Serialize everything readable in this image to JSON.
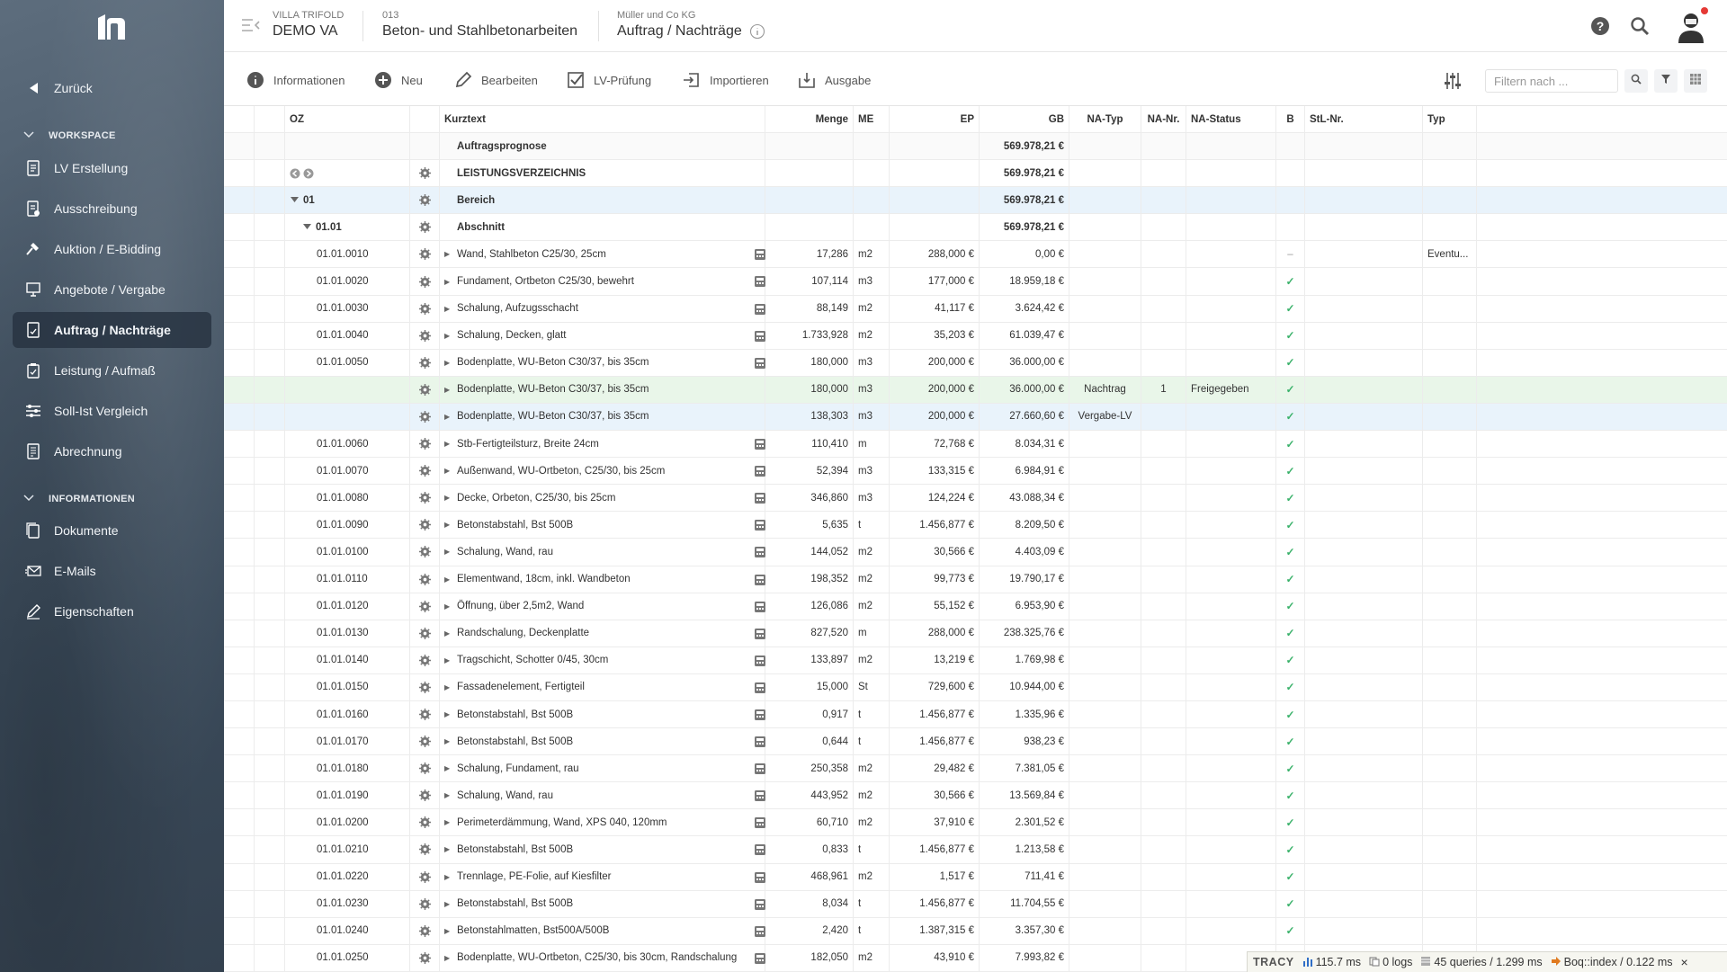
{
  "sidebar": {
    "back_label": "Zurück",
    "section_workspace": "WORKSPACE",
    "section_info": "INFORMATIONEN",
    "workspace_items": [
      {
        "label": "LV Erstellung",
        "icon": "document-icon"
      },
      {
        "label": "Ausschreibung",
        "icon": "tender-icon"
      },
      {
        "label": "Auktion / E-Bidding",
        "icon": "hammer-icon"
      },
      {
        "label": "Angebote / Vergabe",
        "icon": "presentation-icon"
      },
      {
        "label": "Auftrag / Nachträge",
        "icon": "contract-icon",
        "active": true
      },
      {
        "label": "Leistung / Aufmaß",
        "icon": "clipboard-icon"
      },
      {
        "label": "Soll-Ist Vergleich",
        "icon": "sliders-icon"
      },
      {
        "label": "Abrechnung",
        "icon": "invoice-icon"
      }
    ],
    "info_items": [
      {
        "label": "Dokumente",
        "icon": "files-icon"
      },
      {
        "label": "E-Mails",
        "icon": "mail-icon"
      },
      {
        "label": "Eigenschaften",
        "icon": "pencil-icon"
      }
    ]
  },
  "header": {
    "project_small": "VILLA TRIFOLD",
    "project_big": "DEMO VA",
    "lv_small": "013",
    "lv_big": "Beton- und Stahlbetonarbeiten",
    "company_small": "Müller und Co KG",
    "company_big": "Auftrag / Nachträge"
  },
  "toolbar": {
    "informationen": "Informationen",
    "neu": "Neu",
    "bearbeiten": "Bearbeiten",
    "lv_pruefung": "LV-Prüfung",
    "importieren": "Importieren",
    "ausgabe": "Ausgabe",
    "filter_placeholder": "Filtern nach ..."
  },
  "table": {
    "headers": {
      "oz": "OZ",
      "kurztext": "Kurztext",
      "menge": "Menge",
      "me": "ME",
      "ep": "EP",
      "gb": "GB",
      "natyp": "NA-Typ",
      "nanr": "NA-Nr.",
      "nastatus": "NA-Status",
      "b": "B",
      "stlnr": "StL-Nr.",
      "typ": "Typ"
    },
    "rows": [
      {
        "kind": "sum",
        "oz": "",
        "text": "Auftragsprognose",
        "gb": "569.978,21 €"
      },
      {
        "kind": "lv",
        "oz": "",
        "text": "LEISTUNGSVERZEICHNIS",
        "gb": "569.978,21 €"
      },
      {
        "kind": "bereich",
        "oz": "01",
        "text": "Bereich",
        "gb": "569.978,21 €"
      },
      {
        "kind": "abschnitt",
        "oz": "01.01",
        "text": "Abschnitt",
        "gb": "569.978,21 €"
      },
      {
        "kind": "pos",
        "oz": "01.01.0010",
        "text": "Wand, Stahlbeton C25/30, 25cm",
        "menge": "17,286",
        "me": "m2",
        "ep": "288,000 €",
        "gb": "0,00 €",
        "b": "–",
        "typ": "Eventu..."
      },
      {
        "kind": "pos",
        "oz": "01.01.0020",
        "text": "Fundament, Ortbeton C25/30, bewehrt",
        "menge": "107,114",
        "me": "m3",
        "ep": "177,000 €",
        "gb": "18.959,18 €",
        "b": "✓"
      },
      {
        "kind": "pos",
        "oz": "01.01.0030",
        "text": "Schalung, Aufzugsschacht",
        "menge": "88,149",
        "me": "m2",
        "ep": "41,117 €",
        "gb": "3.624,42 €",
        "b": "✓"
      },
      {
        "kind": "pos",
        "oz": "01.01.0040",
        "text": "Schalung, Decken, glatt",
        "menge": "1.733,928",
        "me": "m2",
        "ep": "35,203 €",
        "gb": "61.039,47 €",
        "b": "✓"
      },
      {
        "kind": "pos",
        "oz": "01.01.0050",
        "text": "Bodenplatte, WU-Beton C30/37, bis 35cm",
        "menge": "180,000",
        "me": "m3",
        "ep": "200,000 €",
        "gb": "36.000,00 €",
        "b": "✓"
      },
      {
        "kind": "nachtrag",
        "oz": "",
        "text": "Bodenplatte, WU-Beton C30/37, bis 35cm",
        "menge": "180,000",
        "me": "m3",
        "ep": "200,000 €",
        "gb": "36.000,00 €",
        "natyp": "Nachtrag",
        "nanr": "1",
        "nastatus": "Freigegeben",
        "b": "✓"
      },
      {
        "kind": "vergabe",
        "oz": "",
        "text": "Bodenplatte, WU-Beton C30/37, bis 35cm",
        "menge": "138,303",
        "me": "m3",
        "ep": "200,000 €",
        "gb": "27.660,60 €",
        "natyp": "Vergabe-LV",
        "b": "✓"
      },
      {
        "kind": "pos",
        "oz": "01.01.0060",
        "text": "Stb-Fertigteilsturz, Breite 24cm",
        "menge": "110,410",
        "me": "m",
        "ep": "72,768 €",
        "gb": "8.034,31 €",
        "b": "✓"
      },
      {
        "kind": "pos",
        "oz": "01.01.0070",
        "text": "Außenwand, WU-Ortbeton, C25/30, bis 25cm",
        "menge": "52,394",
        "me": "m3",
        "ep": "133,315 €",
        "gb": "6.984,91 €",
        "b": "✓"
      },
      {
        "kind": "pos",
        "oz": "01.01.0080",
        "text": "Decke, Orbeton, C25/30, bis 25cm",
        "menge": "346,860",
        "me": "m3",
        "ep": "124,224 €",
        "gb": "43.088,34 €",
        "b": "✓"
      },
      {
        "kind": "pos",
        "oz": "01.01.0090",
        "text": "Betonstabstahl, Bst 500B",
        "menge": "5,635",
        "me": "t",
        "ep": "1.456,877 €",
        "gb": "8.209,50 €",
        "b": "✓"
      },
      {
        "kind": "pos",
        "oz": "01.01.0100",
        "text": "Schalung, Wand, rau",
        "menge": "144,052",
        "me": "m2",
        "ep": "30,566 €",
        "gb": "4.403,09 €",
        "b": "✓"
      },
      {
        "kind": "pos",
        "oz": "01.01.0110",
        "text": "Elementwand, 18cm, inkl. Wandbeton",
        "menge": "198,352",
        "me": "m2",
        "ep": "99,773 €",
        "gb": "19.790,17 €",
        "b": "✓"
      },
      {
        "kind": "pos",
        "oz": "01.01.0120",
        "text": "Öffnung, über 2,5m2, Wand",
        "menge": "126,086",
        "me": "m2",
        "ep": "55,152 €",
        "gb": "6.953,90 €",
        "b": "✓"
      },
      {
        "kind": "pos",
        "oz": "01.01.0130",
        "text": "Randschalung, Deckenplatte",
        "menge": "827,520",
        "me": "m",
        "ep": "288,000 €",
        "gb": "238.325,76 €",
        "b": "✓"
      },
      {
        "kind": "pos",
        "oz": "01.01.0140",
        "text": "Tragschicht, Schotter 0/45, 30cm",
        "menge": "133,897",
        "me": "m2",
        "ep": "13,219 €",
        "gb": "1.769,98 €",
        "b": "✓"
      },
      {
        "kind": "pos",
        "oz": "01.01.0150",
        "text": "Fassadenelement, Fertigteil",
        "menge": "15,000",
        "me": "St",
        "ep": "729,600 €",
        "gb": "10.944,00 €",
        "b": "✓"
      },
      {
        "kind": "pos",
        "oz": "01.01.0160",
        "text": "Betonstabstahl, Bst 500B",
        "menge": "0,917",
        "me": "t",
        "ep": "1.456,877 €",
        "gb": "1.335,96 €",
        "b": "✓"
      },
      {
        "kind": "pos",
        "oz": "01.01.0170",
        "text": "Betonstabstahl, Bst 500B",
        "menge": "0,644",
        "me": "t",
        "ep": "1.456,877 €",
        "gb": "938,23 €",
        "b": "✓"
      },
      {
        "kind": "pos",
        "oz": "01.01.0180",
        "text": "Schalung, Fundament, rau",
        "menge": "250,358",
        "me": "m2",
        "ep": "29,482 €",
        "gb": "7.381,05 €",
        "b": "✓"
      },
      {
        "kind": "pos",
        "oz": "01.01.0190",
        "text": "Schalung, Wand, rau",
        "menge": "443,952",
        "me": "m2",
        "ep": "30,566 €",
        "gb": "13.569,84 €",
        "b": "✓"
      },
      {
        "kind": "pos",
        "oz": "01.01.0200",
        "text": "Perimeterdämmung, Wand, XPS 040, 120mm",
        "menge": "60,710",
        "me": "m2",
        "ep": "37,910 €",
        "gb": "2.301,52 €",
        "b": "✓"
      },
      {
        "kind": "pos",
        "oz": "01.01.0210",
        "text": "Betonstabstahl, Bst 500B",
        "menge": "0,833",
        "me": "t",
        "ep": "1.456,877 €",
        "gb": "1.213,58 €",
        "b": "✓"
      },
      {
        "kind": "pos",
        "oz": "01.01.0220",
        "text": "Trennlage, PE-Folie, auf Kiesfilter",
        "menge": "468,961",
        "me": "m2",
        "ep": "1,517 €",
        "gb": "711,41 €",
        "b": "✓"
      },
      {
        "kind": "pos",
        "oz": "01.01.0230",
        "text": "Betonstabstahl, Bst 500B",
        "menge": "8,034",
        "me": "t",
        "ep": "1.456,877 €",
        "gb": "11.704,55 €",
        "b": "✓"
      },
      {
        "kind": "pos",
        "oz": "01.01.0240",
        "text": "Betonstahlmatten, Bst500A/500B",
        "menge": "2,420",
        "me": "t",
        "ep": "1.387,315 €",
        "gb": "3.357,30 €",
        "b": "✓"
      },
      {
        "kind": "pos",
        "oz": "01.01.0250",
        "text": "Bodenplatte, WU-Ortbeton, C25/30, bis 30cm, Randschalung",
        "menge": "182,050",
        "me": "m2",
        "ep": "43,910 €",
        "gb": "7.993,82 €",
        "b": ""
      }
    ]
  },
  "tracy": {
    "label": "TRACY",
    "time": "115.7 ms",
    "logs": "0 logs",
    "queries": "45 queries / 1.299 ms",
    "route": "Boq::index / 0.122 ms",
    "close": "×"
  },
  "colors": {
    "sidebar": "#3a4a5a",
    "check": "#3bb26b",
    "selected_row": "#e9f3fb",
    "nachtrag_row": "#e9f6e9"
  }
}
